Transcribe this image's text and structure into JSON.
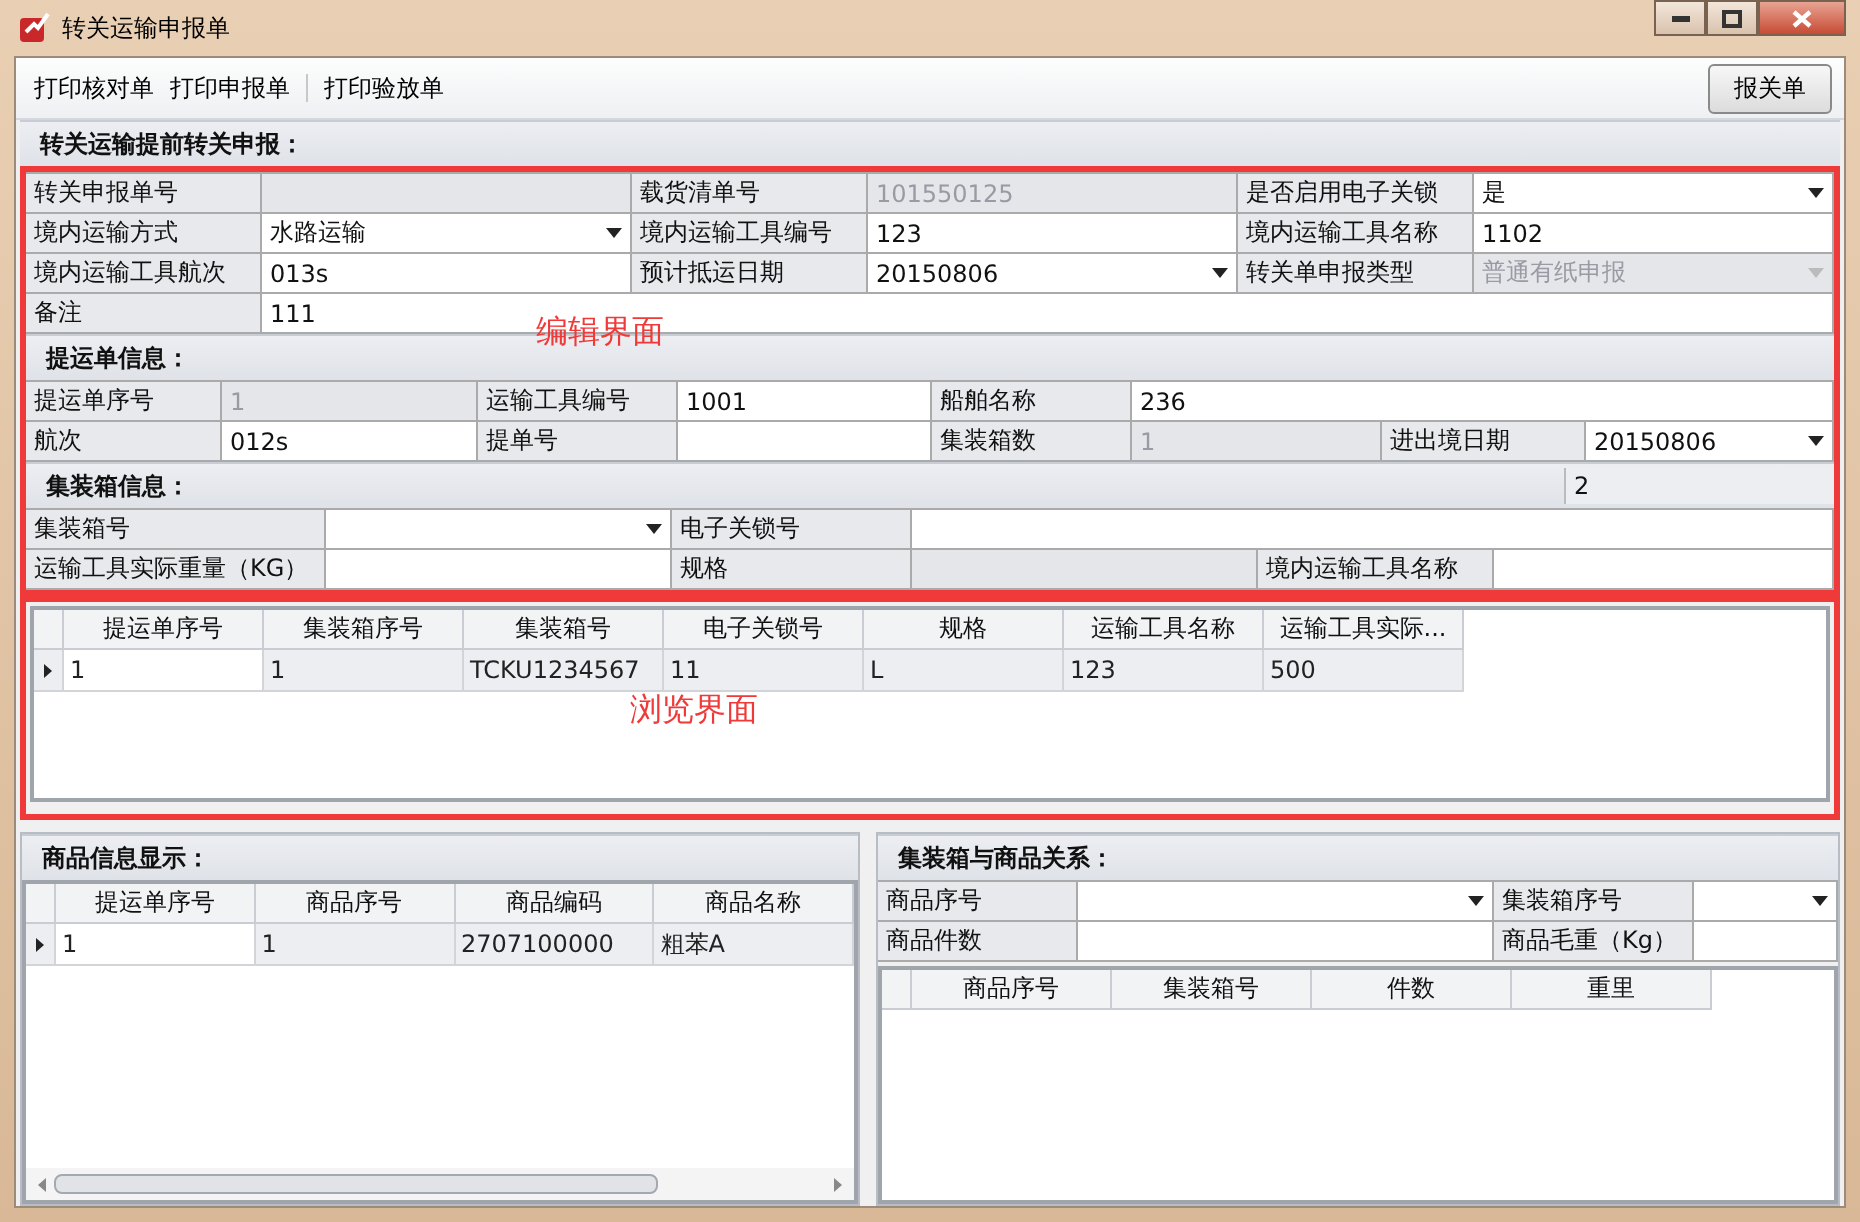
{
  "window": {
    "title": "转关运输申报单"
  },
  "toolbar": {
    "links": [
      "打印核对单",
      "打印申报单",
      "打印验放单"
    ],
    "button": "报关单"
  },
  "sections": [
    {
      "title": "转关运输提前转关申报：",
      "rows": [
        [
          {
            "kind": "label",
            "text": "转关申报单号"
          },
          {
            "kind": "text",
            "disabled": true
          },
          {
            "kind": "label",
            "text": "载货清单号"
          },
          {
            "kind": "text",
            "value": "101550125",
            "disabled": true
          },
          {
            "kind": "label",
            "text": "是否启用电子关锁"
          },
          {
            "kind": "combo",
            "value": "是",
            "disabled": false
          }
        ],
        [
          {
            "kind": "label",
            "text": "境内运输方式"
          },
          {
            "kind": "combo",
            "value": "水路运输",
            "disabled": false
          },
          {
            "kind": "label",
            "text": "境内运输工具编号"
          },
          {
            "kind": "text",
            "value": "123",
            "disabled": false
          },
          {
            "kind": "label",
            "text": "境内运输工具名称"
          },
          {
            "kind": "text",
            "value": "1102",
            "disabled": false
          }
        ],
        [
          {
            "kind": "label",
            "text": "境内运输工具航次"
          },
          {
            "kind": "text",
            "value": "013s",
            "disabled": false
          },
          {
            "kind": "label",
            "text": "预计抵运日期"
          },
          {
            "kind": "combo",
            "value": "20150806",
            "disabled": false
          },
          {
            "kind": "label",
            "text": "转关单申报类型"
          },
          {
            "kind": "combo",
            "value": "普通有纸申报",
            "disabled": true
          }
        ],
        [
          {
            "kind": "label",
            "text": "备注"
          },
          {
            "kind": "text",
            "value": "111",
            "disabled": false
          }
        ]
      ]
    },
    {
      "title": "提运单信息：",
      "rows": [
        [
          {
            "kind": "label",
            "text": "提运单序号"
          },
          {
            "kind": "text",
            "value": "1",
            "disabled": true
          },
          {
            "kind": "label",
            "text": "运输工具编号"
          },
          {
            "kind": "text",
            "value": "1001",
            "disabled": false
          },
          {
            "kind": "label",
            "text": "船舶名称"
          },
          {
            "kind": "text",
            "value": "236",
            "disabled": false
          }
        ],
        [
          {
            "kind": "label",
            "text": "航次"
          },
          {
            "kind": "text",
            "value": "012s",
            "disabled": false
          },
          {
            "kind": "label",
            "text": "提单号"
          },
          {
            "kind": "text",
            "disabled": false
          },
          {
            "kind": "label",
            "text": "集装箱数"
          },
          {
            "kind": "text",
            "value": "1",
            "disabled": true
          },
          {
            "kind": "label",
            "text": "进出境日期"
          },
          {
            "kind": "combo",
            "value": "20150806",
            "disabled": false
          }
        ]
      ]
    },
    {
      "title": "集装箱信息：",
      "header_value": "2",
      "rows": [
        [
          {
            "kind": "label",
            "text": "集装箱号"
          },
          {
            "kind": "combo",
            "disabled": false
          },
          {
            "kind": "label",
            "text": "电子关锁号"
          },
          {
            "kind": "text",
            "disabled": false
          }
        ],
        [
          {
            "kind": "label",
            "text": "运输工具实际重量（KG）"
          },
          {
            "kind": "text",
            "disabled": false
          },
          {
            "kind": "label",
            "text": "规格"
          },
          {
            "kind": "text",
            "disabled": true
          },
          {
            "kind": "label",
            "text": "境内运输工具名称"
          },
          {
            "kind": "text",
            "disabled": false
          }
        ]
      ]
    }
  ],
  "edit_annotation": "编辑界面",
  "browse": {
    "annotation": "浏览界面",
    "columns": [
      "提运单序号",
      "集装箱序号",
      "集装箱号",
      "电子关锁号",
      "规格",
      "运输工具名称",
      "运输工具实际..."
    ],
    "rows": [
      {
        "selected": true,
        "cells": [
          "1",
          "1",
          "TCKU1234567",
          "11",
          "L",
          "123",
          "500"
        ]
      }
    ]
  },
  "goods": {
    "title": "商品信息显示：",
    "columns": [
      "提运单序号",
      "商品序号",
      "商品编码",
      "商品名称"
    ],
    "rows": [
      {
        "selected": true,
        "cells": [
          "1",
          "1",
          "2707100000",
          "粗苯A"
        ]
      }
    ]
  },
  "relation": {
    "title": "集装箱与商品关系：",
    "rows": [
      [
        {
          "kind": "label",
          "text": "商品序号"
        },
        {
          "kind": "combo",
          "disabled": false
        },
        {
          "kind": "label",
          "text": "集装箱序号"
        },
        {
          "kind": "combo",
          "disabled": false
        }
      ],
      [
        {
          "kind": "label",
          "text": "商品件数"
        },
        {
          "kind": "text",
          "disabled": false
        },
        {
          "kind": "label",
          "text": "商品毛重（Kg）"
        },
        {
          "kind": "text",
          "disabled": false
        }
      ]
    ],
    "grid": {
      "columns": [
        "商品序号",
        "集装箱号",
        "件数",
        "重里"
      ]
    }
  }
}
